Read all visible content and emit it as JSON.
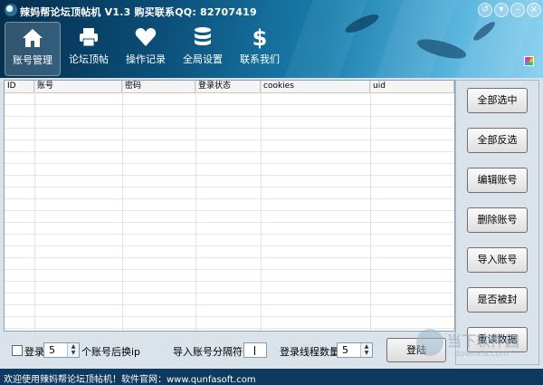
{
  "app": {
    "title": "辣妈帮论坛顶帖机 V1.3 购买联系QQ: 82707419",
    "window_buttons": [
      "↺",
      "▾",
      "–",
      "×"
    ]
  },
  "nav": [
    {
      "label": "账号管理",
      "icon": "home-icon",
      "active": true
    },
    {
      "label": "论坛顶帖",
      "icon": "printer-icon",
      "active": false
    },
    {
      "label": "操作记录",
      "icon": "heart-icon",
      "active": false
    },
    {
      "label": "全局设置",
      "icon": "database-icon",
      "active": false
    },
    {
      "label": "联系我们",
      "icon": "dollar-icon",
      "active": false
    }
  ],
  "table": {
    "columns": [
      "ID",
      "账号",
      "密码",
      "登录状态",
      "cookies",
      "uid"
    ],
    "rows": []
  },
  "side_buttons": [
    "全部选中",
    "全部反选",
    "编辑账号",
    "删除账号",
    "导入账号",
    "是否被封",
    "重读数据"
  ],
  "bottom": {
    "login_checkbox_label": "登录",
    "accounts_per_ip_value": "5",
    "accounts_per_ip_suffix": "个账号后换ip",
    "delimiter_label": "导入账号分隔符：",
    "delimiter_value": "",
    "threads_label": "登录线程数量",
    "threads_value": "5",
    "login_button": "登陆"
  },
  "status": {
    "text": "欢迎使用辣妈帮论坛顶帖机！软件官网：www.qunfasoft.com"
  },
  "watermark": {
    "title": "当下软件园",
    "subtitle": "downxia.com"
  }
}
